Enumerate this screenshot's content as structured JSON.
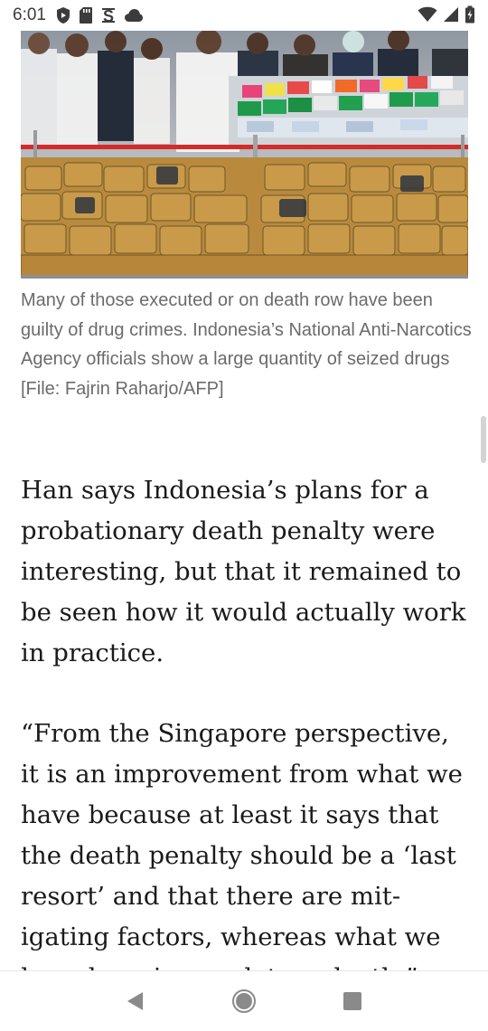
{
  "status_bar": {
    "time": "6:01",
    "left_icons": [
      "shield-play-icon",
      "sd-card-icon",
      "sync-icon",
      "cloud-icon"
    ],
    "right_icons": [
      "wifi-icon",
      "cellular-signal-icon",
      "battery-icon"
    ]
  },
  "article": {
    "photo_alt": "Indonesia's National Anti-Narcotics Agency officials show a large quantity of seized drugs",
    "caption": "Many of those executed or on death row have been guilty of drug crimes. Indonesia’s National Anti-Narcotics Agency officials show a large quantity of seized drugs [File: Fajrin Raharjo/AFP]",
    "paragraphs": [
      "Han says Indonesia’s plans for a probationary death penalty were interesting, but that it remained to be seen how it would actually work in practice.",
      "“From the Singapore perspective, it is an improvement from what we have because at least it says that the death penalty should be a ‘last resort’ and that there are mit­igating factors, whereas what we have here is mandatory death.”"
    ]
  },
  "nav_bar": {
    "buttons": [
      "back-icon",
      "home-icon",
      "recents-icon"
    ]
  },
  "colors": {
    "caption_text": "#6b6b6b",
    "body_text": "#1a1a1a",
    "status_icons": "#3c3c3c",
    "nav_icons": "#8a8a8a"
  }
}
